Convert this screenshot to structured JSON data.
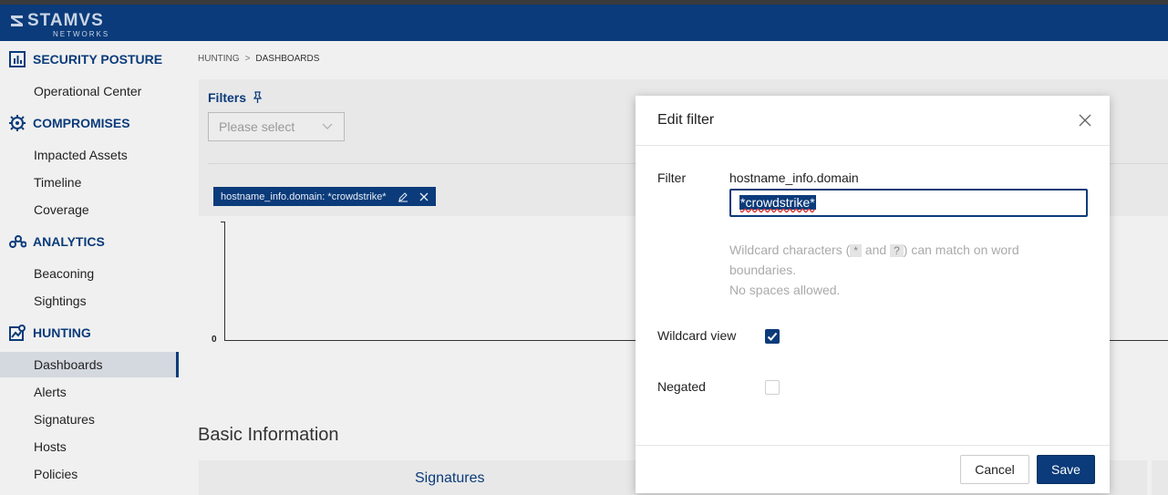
{
  "brand": {
    "name": "STAMVS",
    "sub": "NETWORKS"
  },
  "sidebar": {
    "sections": [
      {
        "label": "SECURITY POSTURE",
        "icon": "bar-chart-icon",
        "items": [
          "Operational Center"
        ]
      },
      {
        "label": "COMPROMISES",
        "icon": "bug-icon",
        "items": [
          "Impacted Assets",
          "Timeline",
          "Coverage"
        ]
      },
      {
        "label": "ANALYTICS",
        "icon": "analytics-icon",
        "items": [
          "Beaconing",
          "Sightings"
        ]
      },
      {
        "label": "HUNTING",
        "icon": "hunting-icon",
        "items": [
          "Dashboards",
          "Alerts",
          "Signatures",
          "Hosts",
          "Policies"
        ]
      }
    ],
    "active_item": "Dashboards"
  },
  "breadcrumb": {
    "parent": "HUNTING",
    "separator": ">",
    "current": "DASHBOARDS"
  },
  "filters": {
    "title": "Filters",
    "select_placeholder": "Please select",
    "chip_text": "hostname_info.domain: *crowdstrike*"
  },
  "chart": {
    "y_zero_label": "0"
  },
  "basic_info": {
    "title": "Basic Information",
    "signatures_title": "Signatures"
  },
  "modal": {
    "title": "Edit filter",
    "filter_label": "Filter",
    "field_name": "hostname_info.domain",
    "input_value": "*crowdstrike*",
    "help_prefix": "Wildcard characters (",
    "help_star": "*",
    "help_and": "and",
    "help_q": "?",
    "help_suffix": ") can match on word boundaries.",
    "help_line2": "No spaces allowed.",
    "wildcard_label": "Wildcard view",
    "wildcard_checked": true,
    "negated_label": "Negated",
    "negated_checked": false,
    "cancel_label": "Cancel",
    "save_label": "Save"
  }
}
